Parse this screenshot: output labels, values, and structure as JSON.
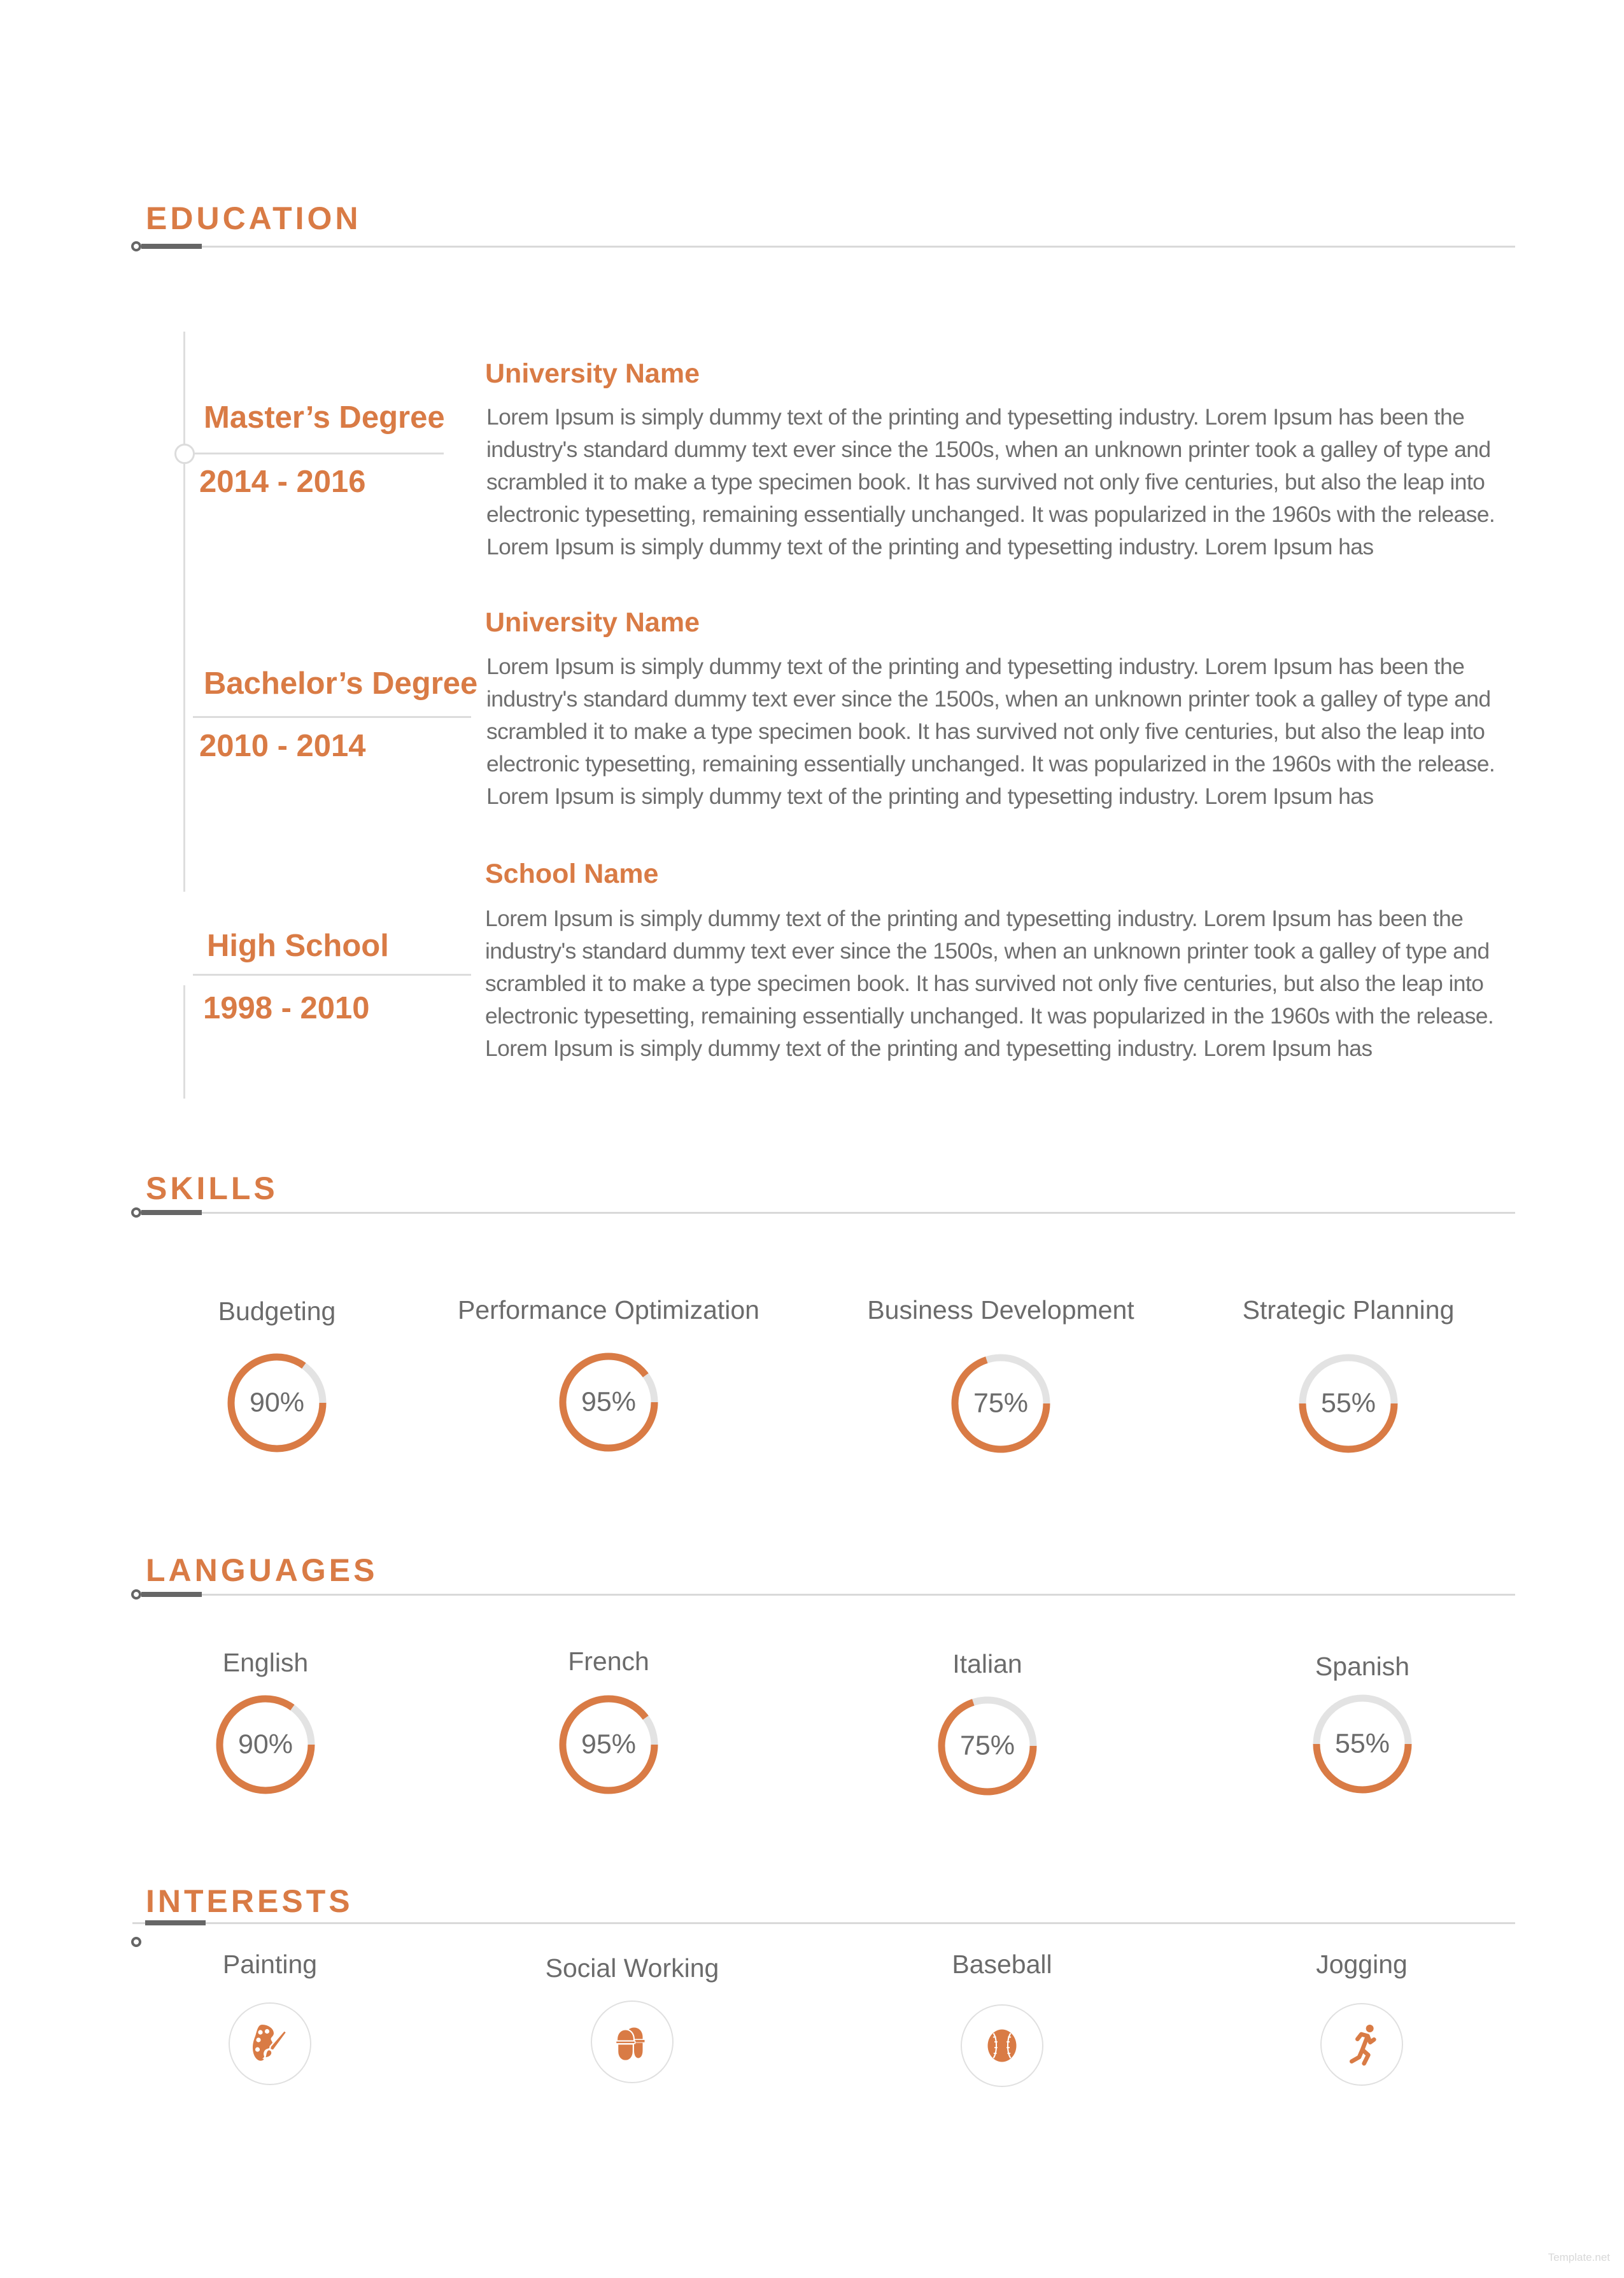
{
  "colors": {
    "accent": "#d97b45",
    "track": "#e3e3e3",
    "text": "#6b6b6b",
    "rule": "#d9d9d9",
    "bar": "#666666"
  },
  "education": {
    "title": "EDUCATION",
    "entries": [
      {
        "degree": "Master’s Degree",
        "dates": "2014 - 2016",
        "institution": "University Name",
        "description": "Lorem Ipsum is simply dummy text of the printing and typesetting industry. Lorem Ipsum has been the industry's standard dummy text ever since the 1500s, when an unknown printer took a galley of type and scrambled it to make a type specimen book. It has survived not only five centuries, but also the leap into electronic typesetting, remaining essentially unchanged. It was popularized in the 1960s with the release. Lorem Ipsum is simply dummy text of the printing and typesetting industry. Lorem Ipsum has"
      },
      {
        "degree": "Bachelor’s Degree",
        "dates": "2010 - 2014",
        "institution": "University Name",
        "description": "Lorem Ipsum is simply dummy text of the printing and typesetting industry. Lorem Ipsum has been the industry's standard dummy text ever since the 1500s, when an unknown printer took a galley of type and scrambled it to make a type specimen book. It has survived not only five centuries, but also the leap into electronic typesetting, remaining essentially unchanged. It was popularized in the 1960s with the release. Lorem Ipsum is simply dummy text of the printing and typesetting industry. Lorem Ipsum has"
      },
      {
        "degree": "High School",
        "dates": "1998 - 2010",
        "institution": "School Name",
        "description": "Lorem Ipsum is simply dummy text of the printing and typesetting industry. Lorem Ipsum has been the industry's standard dummy text ever since the 1500s, when an unknown printer took a galley of type and scrambled it to make a type specimen book. It has survived not only five centuries, but also the leap into electronic typesetting, remaining essentially unchanged. It was popularized in the 1960s with the release. Lorem Ipsum is simply dummy text of the printing and typesetting industry. Lorem Ipsum has"
      }
    ]
  },
  "skills": {
    "title": "SKILLS",
    "items": [
      {
        "label": "Budgeting",
        "value": 90,
        "value_label": "90%"
      },
      {
        "label": "Performance Optimization",
        "value": 95,
        "value_label": "95%"
      },
      {
        "label": "Business Development",
        "value": 75,
        "value_label": "75%"
      },
      {
        "label": "Strategic Planning",
        "value": 55,
        "value_label": "55%"
      }
    ]
  },
  "languages": {
    "title": "LANGUAGES",
    "items": [
      {
        "label": "English",
        "value": 90,
        "value_label": "90%"
      },
      {
        "label": "French",
        "value": 95,
        "value_label": "95%"
      },
      {
        "label": "Italian",
        "value": 75,
        "value_label": "75%"
      },
      {
        "label": "Spanish",
        "value": 55,
        "value_label": "55%"
      }
    ]
  },
  "interests": {
    "title": "INTERESTS",
    "items": [
      {
        "label": "Painting",
        "icon": "palette-icon"
      },
      {
        "label": "Social Working",
        "icon": "workers-icon"
      },
      {
        "label": "Baseball",
        "icon": "baseball-icon"
      },
      {
        "label": "Jogging",
        "icon": "runner-icon"
      }
    ]
  },
  "watermark": "Template.net"
}
